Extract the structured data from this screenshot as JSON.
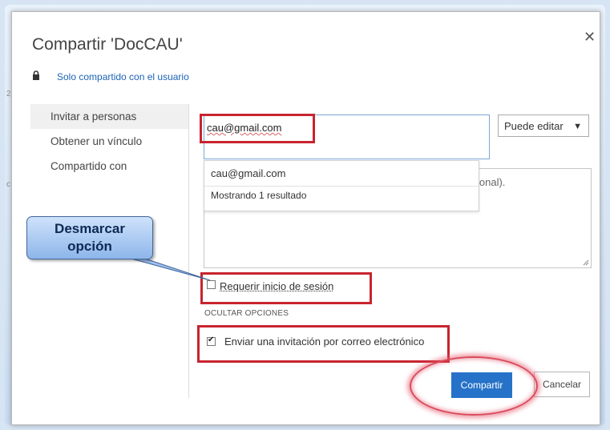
{
  "dialog": {
    "title": "Compartir 'DocCAU'",
    "close_glyph": "✕",
    "sharing_status": "Solo compartido con el usuario"
  },
  "sidebar": {
    "items": [
      {
        "label": "Invitar a personas"
      },
      {
        "label": "Obtener un vínculo"
      },
      {
        "label": "Compartido con"
      }
    ]
  },
  "invite": {
    "value": "cau@gmail.com",
    "permission": "Puede editar",
    "permission_caret": "▼"
  },
  "message": {
    "placeholder_visible": "ional)."
  },
  "suggestions": {
    "items": [
      "cau@gmail.com"
    ],
    "count_text": "Mostrando 1 resultado"
  },
  "options": {
    "require_signin_label": "Requerir inicio de sesión",
    "require_signin_checked": false,
    "hide_options_label": "OCULTAR OPCIONES",
    "send_invitation_label": "Enviar una invitación por correo electrónico",
    "send_invitation_checked": true
  },
  "buttons": {
    "share_label": "Compartir",
    "cancel_label": "Cancelar"
  },
  "annotation": {
    "callout_line1": "Desmarcar",
    "callout_line2": "opción"
  },
  "colors": {
    "accent": "#2672c8",
    "highlight_red": "#c8242f",
    "link": "#1c63b7"
  }
}
